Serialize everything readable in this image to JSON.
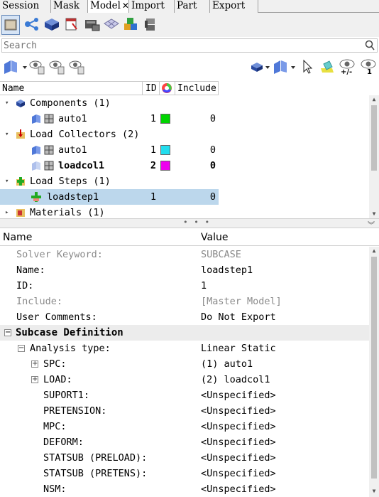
{
  "tabs": [
    {
      "label": "Session"
    },
    {
      "label": "Mask"
    },
    {
      "label": "Model",
      "close": "✕",
      "active": true
    },
    {
      "label": "Import"
    },
    {
      "label": "Part"
    },
    {
      "label": "Export"
    }
  ],
  "search": {
    "placeholder": "Search"
  },
  "tree": {
    "headers": {
      "name": "Name",
      "id": "ID",
      "include": "Include"
    },
    "rows": [
      {
        "label": "Components (1)",
        "type": "folder",
        "level": 0
      },
      {
        "label": "auto1",
        "id": "1",
        "color": "#00d400",
        "include": "0",
        "level": 1
      },
      {
        "label": "Load Collectors (2)",
        "type": "folder",
        "level": 0
      },
      {
        "label": "auto1",
        "id": "1",
        "color": "#22ddee",
        "include": "0",
        "level": 1
      },
      {
        "label": "loadcol1",
        "id": "2",
        "color": "#ee00ee",
        "include": "0",
        "level": 1,
        "bold": true
      },
      {
        "label": "Load Steps (1)",
        "type": "folder",
        "level": 0
      },
      {
        "label": "loadstep1",
        "id": "1",
        "include": "0",
        "level": 1,
        "selected": true
      },
      {
        "label": "Materials (1)",
        "type": "folder",
        "level": 0
      }
    ]
  },
  "props": {
    "headers": {
      "name": "Name",
      "value": "Value"
    },
    "rows": [
      {
        "name": "Solver Keyword:",
        "value": "SUBCASE",
        "grey": true
      },
      {
        "name": "Name:",
        "value": "loadstep1"
      },
      {
        "name": "ID:",
        "value": "1"
      },
      {
        "name": "Include:",
        "value": "[Master Model]",
        "grey": true
      },
      {
        "name": "User Comments:",
        "value": "Do Not Export"
      },
      {
        "name": "Subcase Definition",
        "value": "",
        "group": true
      },
      {
        "name": "Analysis type:",
        "value": "Linear Static"
      },
      {
        "name": "SPC:",
        "value": "(1) auto1"
      },
      {
        "name": "LOAD:",
        "value": "(2) loadcol1"
      },
      {
        "name": "SUPORT1:",
        "value": "<Unspecified>"
      },
      {
        "name": "PRETENSION:",
        "value": "<Unspecified>"
      },
      {
        "name": "MPC:",
        "value": "<Unspecified>"
      },
      {
        "name": "DEFORM:",
        "value": "<Unspecified>"
      },
      {
        "name": "STATSUB (PRELOAD):",
        "value": "<Unspecified>"
      },
      {
        "name": "STATSUB (PRETENS):",
        "value": "<Unspecified>"
      },
      {
        "name": "NSM:",
        "value": "<Unspecified>"
      }
    ]
  },
  "toolbar2": {
    "minus_label": "+/-",
    "count_label": "1"
  },
  "splitter": {
    "grip": "• • •"
  }
}
